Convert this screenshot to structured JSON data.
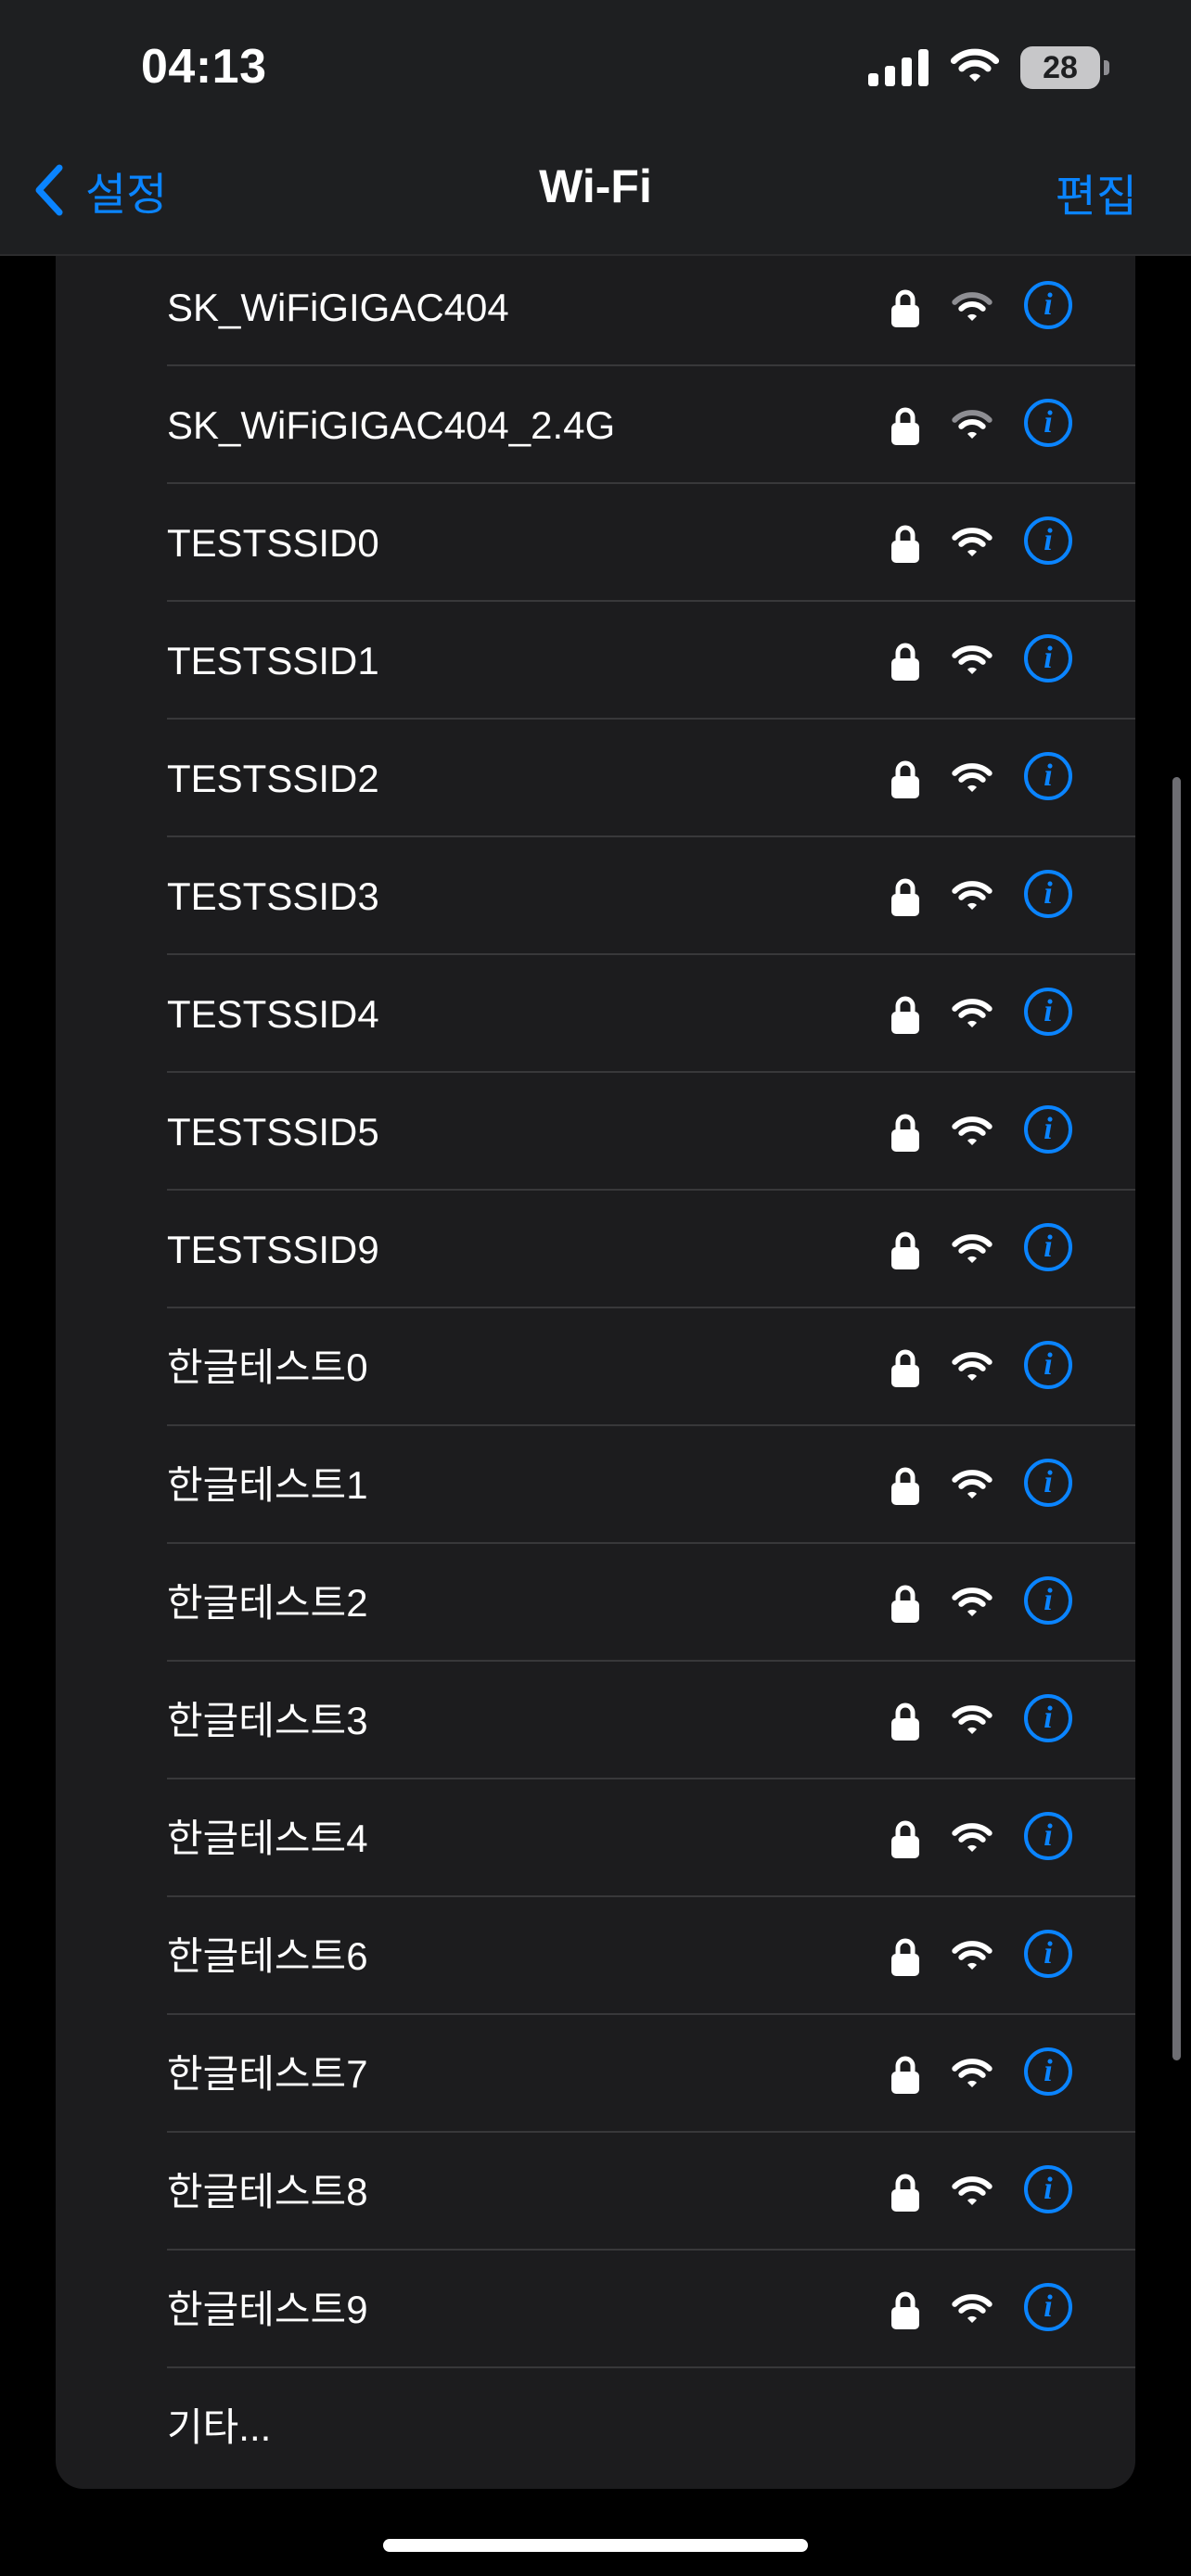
{
  "status_bar": {
    "time": "04:13",
    "battery_level": "28",
    "icons": [
      "cellular-signal-icon",
      "wifi-icon",
      "battery-icon"
    ]
  },
  "nav": {
    "back_label": "설정",
    "title": "Wi-Fi",
    "edit_label": "편집"
  },
  "networks": [
    {
      "name": "SK_WiFiGIGAC404",
      "secured": true,
      "signal": "medium"
    },
    {
      "name": "SK_WiFiGIGAC404_2.4G",
      "secured": true,
      "signal": "medium"
    },
    {
      "name": "TESTSSID0",
      "secured": true,
      "signal": "full"
    },
    {
      "name": "TESTSSID1",
      "secured": true,
      "signal": "full"
    },
    {
      "name": "TESTSSID2",
      "secured": true,
      "signal": "full"
    },
    {
      "name": "TESTSSID3",
      "secured": true,
      "signal": "full"
    },
    {
      "name": "TESTSSID4",
      "secured": true,
      "signal": "full"
    },
    {
      "name": "TESTSSID5",
      "secured": true,
      "signal": "full"
    },
    {
      "name": "TESTSSID9",
      "secured": true,
      "signal": "full"
    },
    {
      "name": "한글테스트0",
      "secured": true,
      "signal": "full"
    },
    {
      "name": "한글테스트1",
      "secured": true,
      "signal": "full"
    },
    {
      "name": "한글테스트2",
      "secured": true,
      "signal": "full"
    },
    {
      "name": "한글테스트3",
      "secured": true,
      "signal": "full"
    },
    {
      "name": "한글테스트4",
      "secured": true,
      "signal": "full"
    },
    {
      "name": "한글테스트6",
      "secured": true,
      "signal": "full"
    },
    {
      "name": "한글테스트7",
      "secured": true,
      "signal": "full"
    },
    {
      "name": "한글테스트8",
      "secured": true,
      "signal": "full"
    },
    {
      "name": "한글테스트9",
      "secured": true,
      "signal": "full"
    }
  ],
  "other_label": "기타...",
  "colors": {
    "accent": "#0a84ff",
    "background": "#000000",
    "card": "#1c1c1e",
    "separator": "#38383a",
    "signal_dim": "#8e8e93"
  }
}
